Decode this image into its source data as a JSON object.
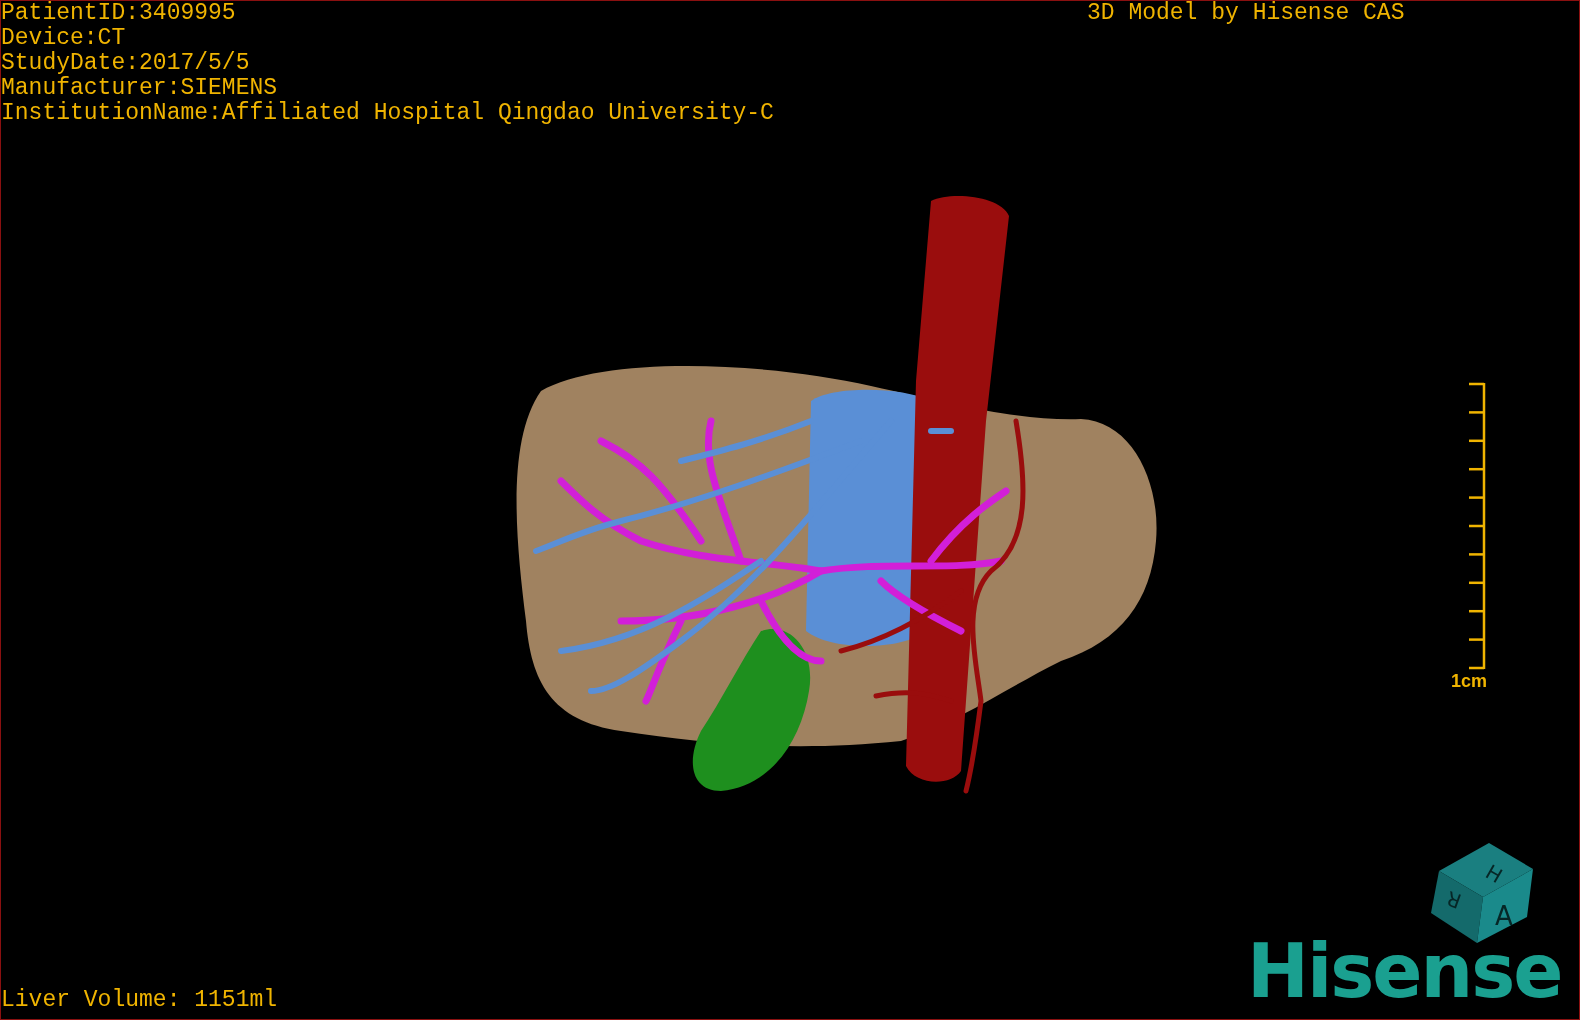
{
  "study_info": [
    "PatientID:3409995",
    "Device:CT",
    "StudyDate:2017/5/5",
    "Manufacturer:SIEMENS",
    "InstitutionName:Affiliated Hospital Qingdao University-C"
  ],
  "title": "3D Model by Hisense CAS",
  "scale_bar": {
    "label": "1cm"
  },
  "liver_volume": "Liver Volume: 1151ml",
  "orientation_cube": {
    "top": "H",
    "left": "R",
    "front": "A"
  },
  "logo": "Hisense"
}
